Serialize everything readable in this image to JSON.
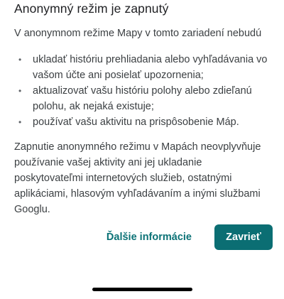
{
  "dialog": {
    "title": "Anonymný režim je zapnutý",
    "intro": "V anonymnom režime Mapy v tomto zariadení nebudú",
    "bullets": [
      "ukladať históriu prehliadania alebo vyhľadávania vo vašom účte ani posielať upozornenia;",
      "aktualizovať vašu históriu polohy alebo zdieľanú polohu, ak nejaká existuje;",
      "používať vašu aktivitu na prispôsobenie Máp."
    ],
    "paragraph": "Zapnutie anonymného režimu v Mapách neovplyvňuje používanie vašej aktivity ani jej ukladanie poskytovateľmi internetových služieb, ostatnými aplikáciami, hlasovým vyhľadávaním a inými službami Googlu.",
    "more_info_label": "Ďalšie informácie",
    "close_label": "Zavrieť"
  },
  "colors": {
    "accent": "#0b6e73",
    "link": "#0b7276"
  }
}
